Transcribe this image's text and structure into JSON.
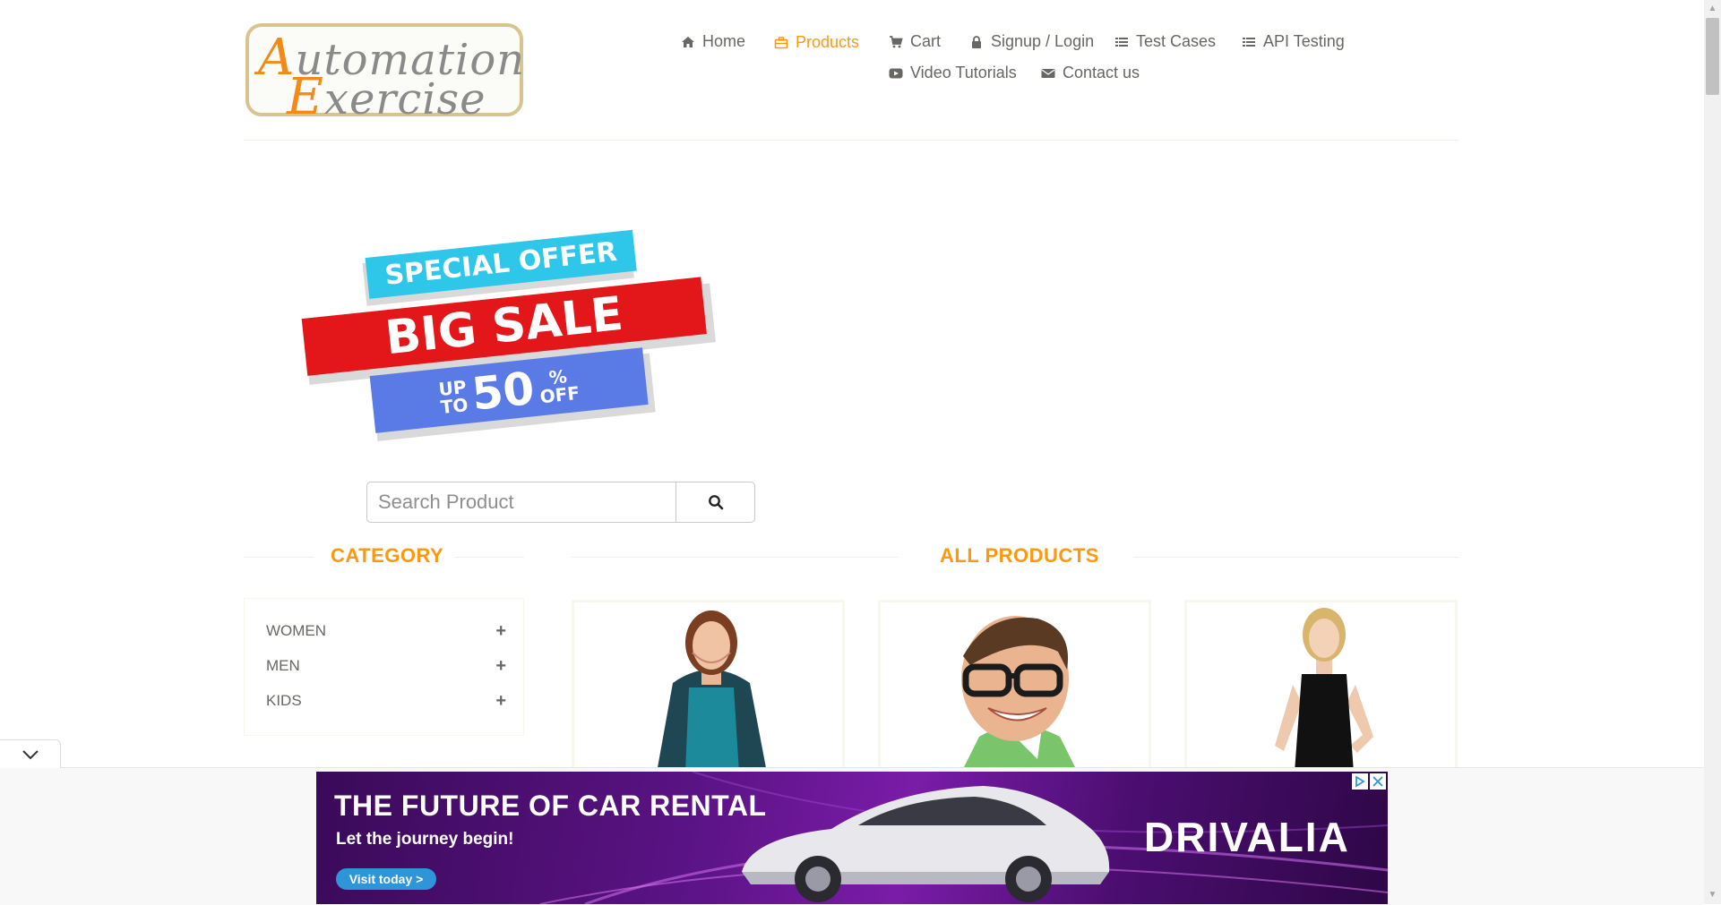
{
  "header": {
    "logo": {
      "line1_first": "A",
      "line1_rest": "utomation",
      "line2_first": "E",
      "line2_rest": "xercise"
    },
    "nav": [
      {
        "label": "Home",
        "icon": "home-icon"
      },
      {
        "label": "Products",
        "icon": "briefcase-icon",
        "active": true
      },
      {
        "label": "Cart",
        "icon": "cart-icon"
      },
      {
        "label": "Signup / Login",
        "icon": "lock-icon"
      },
      {
        "label": "Test Cases",
        "icon": "list-icon"
      },
      {
        "label": "API Testing",
        "icon": "list-icon"
      },
      {
        "label": "Video Tutorials",
        "icon": "youtube-play-icon"
      },
      {
        "label": "Contact us",
        "icon": "envelope-icon"
      }
    ]
  },
  "banner": {
    "line1": "SPECIAL OFFER",
    "line2": "BIG SALE",
    "line3_a": "UP",
    "line3_b": "TO",
    "line3_num": "50",
    "line3_pct": "%",
    "line3_off": "OFF",
    "colors": {
      "cyan": "#2ec7ea",
      "red": "#e3161a",
      "blue": "#5a7be6"
    }
  },
  "search": {
    "placeholder": "Search Product",
    "value": "",
    "icon": "search-icon"
  },
  "sidebar": {
    "title": "CATEGORY",
    "categories": [
      {
        "label": "WOMEN",
        "icon": "plus-icon"
      },
      {
        "label": "MEN",
        "icon": "plus-icon"
      },
      {
        "label": "KIDS",
        "icon": "plus-icon"
      }
    ]
  },
  "products": {
    "title": "ALL PRODUCTS",
    "cards": [
      {
        "image": "woman-teal-cardigan-image"
      },
      {
        "image": "man-glasses-image"
      },
      {
        "image": "woman-black-top-image"
      }
    ]
  },
  "ad": {
    "headline": "THE FUTURE OF CAR RENTAL",
    "subline": "Let the journey begin!",
    "cta": "Visit today >",
    "brand": "DRIVALIA",
    "colors": {
      "accent": "#2d95d8"
    }
  },
  "colors": {
    "brand_orange": "#fe980f",
    "text_gray": "#696763"
  }
}
